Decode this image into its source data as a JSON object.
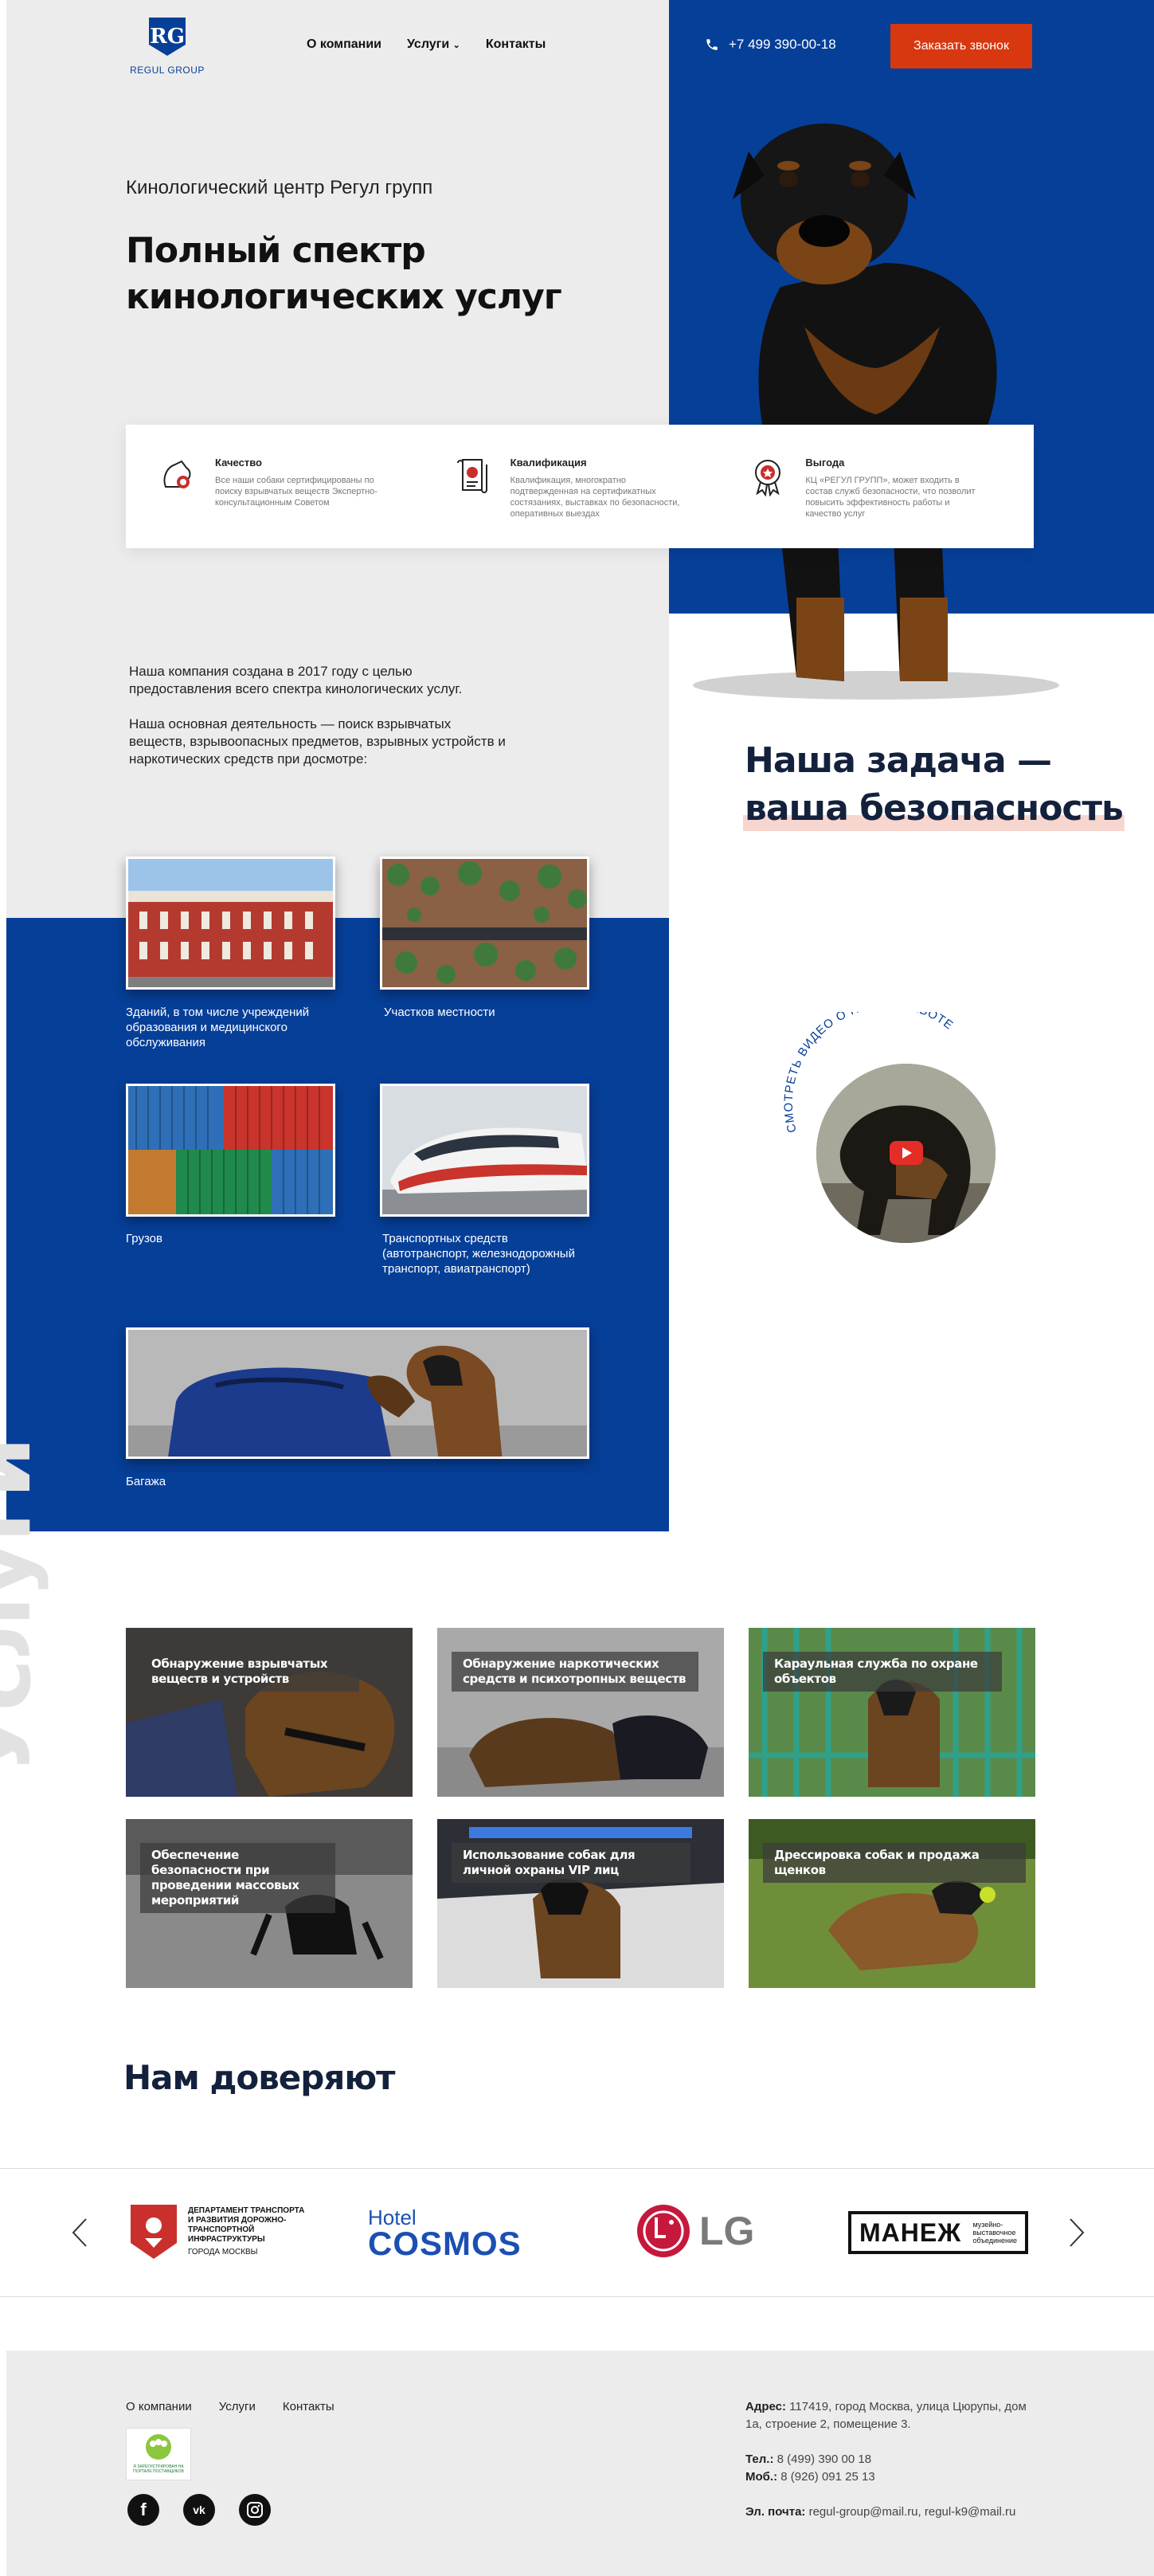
{
  "header": {
    "logo_mark": "RG",
    "logo_text": "REGUL GROUP",
    "nav": [
      "О компании",
      "Услуги",
      "Контакты"
    ],
    "phone": "+7 499 390-00-18",
    "call_button": "Заказать звонок"
  },
  "hero": {
    "subtitle": "Кинологический центр Регул групп",
    "title_line1": "Полный спектр",
    "title_line2": "кинологических услуг"
  },
  "features": [
    {
      "title": "Качество",
      "text": "Все наши собаки сертифицированы по поиску взрывчатых веществ Экспертно-консультационным Советом",
      "icon": "dog-medal-icon"
    },
    {
      "title": "Квалификация",
      "text": "Квалификация, многократно подтвержденная на сертификатных состязаниях, выставках по безопасности, оперативных выездах",
      "icon": "diploma-icon"
    },
    {
      "title": "Выгода",
      "text": "КЦ «РЕГУЛ ГРУПП», может входить в состав служб безопасности, что позволит повысить эффективность работы и качество услуг",
      "icon": "award-icon"
    }
  ],
  "about": {
    "p1": "Наша компания создана в 2017 году с целью предоставления всего спектра кинологических услуг.",
    "p2": "Наша основная деятельность — поиск взрывчатых веществ, взрывоопасных предметов, взрывных устройств и наркотических средств при досмотре:"
  },
  "mission": {
    "line1": "Наша задача —",
    "line2": "ваша безопасность"
  },
  "inspection": [
    {
      "label": "Зданий, в том числе учреждений образования и медицинского обслуживания"
    },
    {
      "label": "Участков местности"
    },
    {
      "label": "Грузов"
    },
    {
      "label": "Транспортных средств (автотранспорт, железнодорожный транспорт, авиатранспорт)"
    },
    {
      "label": "Багажа"
    }
  ],
  "video": {
    "caption": "СМОТРЕТЬ ВИДЕО  О НАШЕЙ РАБОТЕ"
  },
  "services": {
    "vertical_title": "Услуги",
    "items": [
      "Обнаружение взрывчатых веществ и устройств",
      "Обнаружение наркотических средств и психотропных веществ",
      "Караульная служба по охране объектов",
      "Обеспечение безопасности при проведении массовых мероприятий",
      "Использование собак для личной охраны VIP лиц",
      "Дрессировка собак и продажа щенков"
    ]
  },
  "trust": {
    "title": "Нам доверяют",
    "dept_line1": "ДЕПАРТАМЕНТ ТРАНСПОРТА",
    "dept_line2": "И РАЗВИТИЯ ДОРОЖНО-",
    "dept_line3": "ТРАНСПОРТНОЙ",
    "dept_line4": "ИНФРАСТРУКТУРЫ",
    "dept_line5": "ГОРОДА МОСКВЫ",
    "hotel_top": "Hotel",
    "hotel_main": "COSMOS",
    "lg_text": "LG",
    "manege_main": "МАНЕЖ",
    "manege_sub1": "музейно-",
    "manege_sub2": "выставочное",
    "manege_sub3": "объединение"
  },
  "footer": {
    "nav": [
      "О компании",
      "Услуги",
      "Контакты"
    ],
    "badge_text": "Я ЗАРЕГИСТРИРОВАН НА ПОРТАЛЕ ПОСТАВЩИКОВ",
    "address_label": "Адрес:",
    "address": "117419, город Москва, улица Цюрупы, дом 1а, строение 2, помещение 3.",
    "tel_label": "Тел.:",
    "tel": "8 (499) 390 00 18",
    "mob_label": "Моб.:",
    "mob": "8 (926) 091 25 13",
    "email_label": "Эл. почта:",
    "email": "regul-group@mail.ru, regul-k9@mail.ru"
  },
  "colors": {
    "brand_blue": "#063f98",
    "accent": "#d7380f",
    "grey_bg": "#ececec"
  }
}
